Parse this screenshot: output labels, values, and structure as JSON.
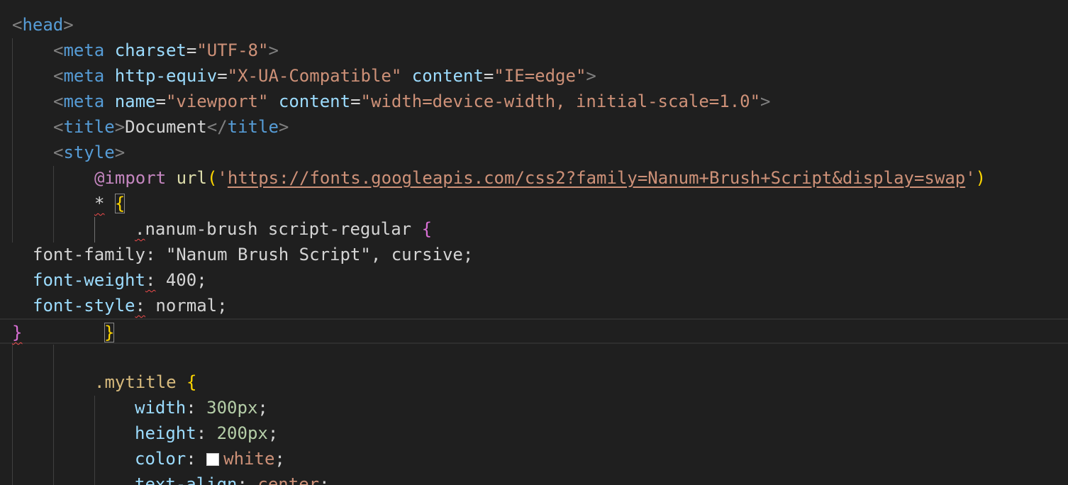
{
  "editor": {
    "lines": {
      "l1": {
        "open": "<",
        "tag": "head",
        "close": ">"
      },
      "l2": {
        "open": "<",
        "tag": "meta",
        "attr": "charset",
        "eq": "=",
        "val": "\"UTF-8\"",
        "close": ">"
      },
      "l3": {
        "open": "<",
        "tag": "meta",
        "attr1": "http-equiv",
        "eq1": "=",
        "val1": "\"X-UA-Compatible\"",
        "attr2": "content",
        "eq2": "=",
        "val2": "\"IE=edge\"",
        "close": ">"
      },
      "l4": {
        "open": "<",
        "tag": "meta",
        "attr1": "name",
        "eq1": "=",
        "val1": "\"viewport\"",
        "attr2": "content",
        "eq2": "=",
        "val2": "\"width=device-width, initial-scale=1.0\"",
        "close": ">"
      },
      "l5": {
        "open": "<",
        "tag": "title",
        "mid": ">",
        "text": "Document",
        "endopen": "</",
        "endtag": "title",
        "close": ">"
      },
      "l6": {
        "open": "<",
        "tag": "style",
        "close": ">"
      },
      "l7": {
        "at": "@import",
        "func": "url",
        "lparen": "(",
        "q1": "'",
        "url": "https://fonts.googleapis.com/css2?family=Nanum+Brush+Script&display=swap",
        "q2": "'",
        "rparen": ")"
      },
      "l8": {
        "star": "*",
        "brace": "{"
      },
      "l9": {
        "dot": ".",
        "selector": "nanum-brush script-regular",
        "brace": "{"
      },
      "l10": {
        "text": "font-family: \"Nanum Brush Script\", cursive;"
      },
      "l11": {
        "prop": "font-weight",
        "colon": ":",
        "value": " 400;"
      },
      "l12": {
        "prop": "font-style",
        "colon": ":",
        "value": " normal;"
      },
      "l13": {
        "brace1": "}",
        "brace2": "}"
      },
      "l15": {
        "selector": ".mytitle",
        "brace": "{"
      },
      "l16": {
        "prop": "width",
        "colon": ": ",
        "value": "300px",
        "semi": ";"
      },
      "l17": {
        "prop": "height",
        "colon": ": ",
        "value": "200px",
        "semi": ";"
      },
      "l18": {
        "prop": "color",
        "colon": ": ",
        "value": "white",
        "semi": ";"
      },
      "l19": {
        "prop": "text-align",
        "colon": ": ",
        "value": "center",
        "semi": ";"
      }
    }
  },
  "colors": {
    "background": "#1f1f1f",
    "tag": "#569cd6",
    "attribute": "#9cdcfe",
    "string": "#ce9178",
    "error_squiggle": "#f14c4c",
    "brace_yellow": "#ffd700",
    "brace_purple": "#da70d6"
  }
}
